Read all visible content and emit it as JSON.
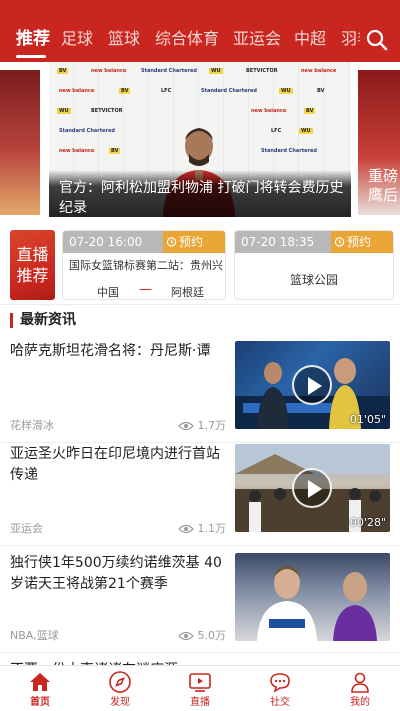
{
  "nav": {
    "tabs": [
      "推荐",
      "足球",
      "篮球",
      "综合体育",
      "亚运会",
      "中超",
      "羽毛"
    ],
    "active_index": 0
  },
  "carousel": {
    "main_caption": "官方：阿利松加盟利物浦 打破门将转会费历史纪录",
    "right_caption": "重磅 鹰后"
  },
  "live": {
    "label": "直播推荐",
    "cards": [
      {
        "time": "07-20 16:00",
        "reserve": "预约",
        "title": "国际女篮锦标赛第二站：贵州兴",
        "team_a": "中国",
        "vs": "—",
        "team_b": "阿根廷"
      },
      {
        "time": "07-20 18:35",
        "reserve": "预约",
        "title": "篮球公园"
      }
    ]
  },
  "news": {
    "section_title": "最新资讯",
    "items": [
      {
        "title": "哈萨克斯坦花滑名将：丹尼斯·谭",
        "source": "花样滑冰",
        "views": "1.7万",
        "duration": "01'05\""
      },
      {
        "title": "亚运圣火昨日在印尼境内进行首站传递",
        "source": "亚运会",
        "views": "1.1万",
        "duration": "00'28\""
      },
      {
        "title": "独行侠1年500万续约诺维茨基 40岁诺天王将战第21个赛季",
        "source": "NBA,篮球",
        "views": "5.0万",
        "duration": ""
      },
      {
        "title": "不要一份大事诸诸在谜底源",
        "source": "",
        "views": "",
        "duration": ""
      }
    ]
  },
  "bottom_tabs": [
    "首页",
    "发现",
    "直播",
    "社交",
    "我的"
  ],
  "colors": {
    "brand": "#c8261f",
    "reserve": "#e9a637"
  }
}
